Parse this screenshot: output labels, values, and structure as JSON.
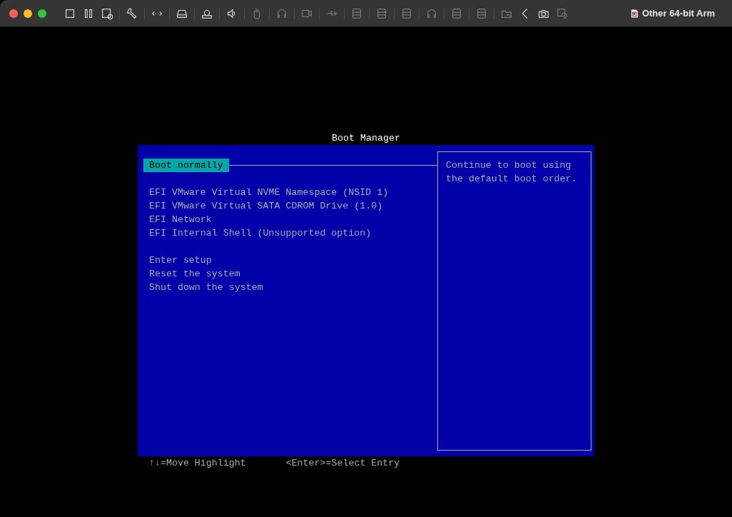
{
  "toolbar": {
    "controls": [
      {
        "color": "#ff5f57"
      },
      {
        "color": "#febc2e"
      },
      {
        "color": "#28c840"
      }
    ],
    "button_groups": [
      [
        {
          "kind": "stop",
          "disabled": false
        },
        {
          "kind": "pause",
          "disabled": false
        },
        {
          "kind": "screenshot",
          "disabled": false
        }
      ],
      [
        {
          "kind": "wrench",
          "disabled": false
        }
      ],
      [
        {
          "kind": "network",
          "disabled": false
        }
      ],
      [
        {
          "kind": "drive",
          "disabled": false
        }
      ],
      [
        {
          "kind": "printer",
          "disabled": false
        }
      ],
      [
        {
          "kind": "speaker",
          "disabled": false
        }
      ],
      [
        {
          "kind": "mouse",
          "disabled": true
        }
      ],
      [
        {
          "kind": "headphones",
          "disabled": true
        }
      ],
      [
        {
          "kind": "video",
          "disabled": true
        }
      ],
      [
        {
          "kind": "usb",
          "disabled": true
        }
      ],
      [
        {
          "kind": "storage",
          "disabled": true
        }
      ],
      [
        {
          "kind": "storage",
          "disabled": true
        }
      ],
      [
        {
          "kind": "storage",
          "disabled": true
        }
      ],
      [
        {
          "kind": "headphones",
          "disabled": true
        }
      ],
      [
        {
          "kind": "storage",
          "disabled": true
        }
      ],
      [
        {
          "kind": "storage",
          "disabled": true
        }
      ],
      [
        {
          "kind": "folder",
          "disabled": true
        },
        {
          "kind": "chevron",
          "disabled": false
        },
        {
          "kind": "camera",
          "disabled": false
        },
        {
          "kind": "restore",
          "disabled": true
        }
      ]
    ],
    "window_title": "Other 64-bit Arm"
  },
  "boot_manager": {
    "title": "Boot Manager",
    "groups": [
      {
        "items": [
          {
            "label": "Boot normally",
            "selected": true
          }
        ]
      },
      {
        "items": [
          {
            "label": "EFI VMware Virtual NVME Namespace (NSID 1)",
            "selected": false
          },
          {
            "label": "EFI VMware Virtual SATA CDROM Drive (1.0)",
            "selected": false
          },
          {
            "label": "EFI Network",
            "selected": false
          },
          {
            "label": "EFI Internal Shell (Unsupported option)",
            "selected": false
          }
        ]
      },
      {
        "items": [
          {
            "label": "Enter setup",
            "selected": false
          },
          {
            "label": "Reset the system",
            "selected": false
          },
          {
            "label": "Shut down the system",
            "selected": false
          }
        ]
      }
    ],
    "help_text": [
      "Continue to boot using",
      "the default boot order."
    ],
    "footer": [
      "↑↓=Move Highlight",
      "<Enter>=Select Entry"
    ]
  }
}
